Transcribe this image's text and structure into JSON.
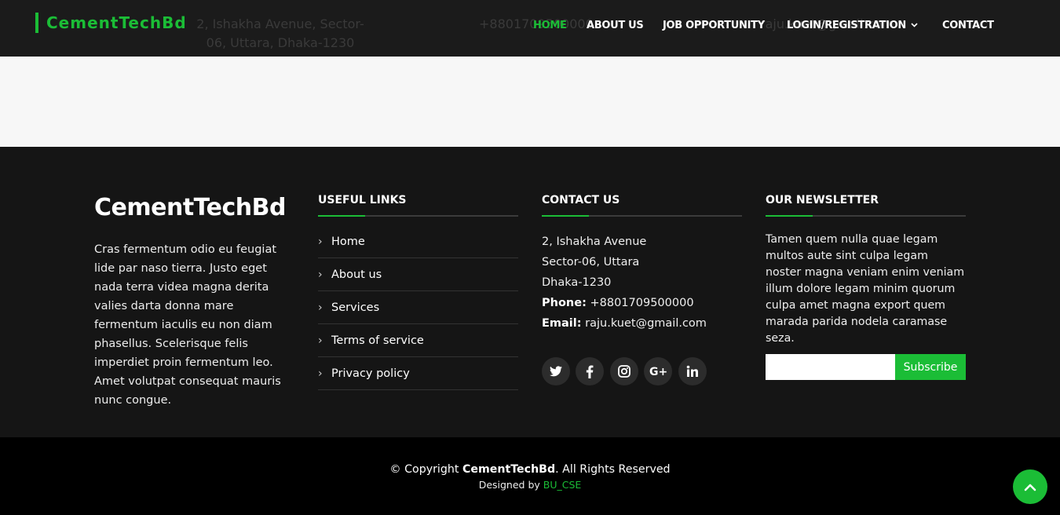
{
  "header": {
    "logo": "CementTechBd",
    "background_text": {
      "address": "2, Ishakha Avenue, Sector-06, Uttara, Dhaka-1230",
      "phone": "+8801709500000",
      "email": "raju.kuet@gmail.com"
    },
    "nav": [
      {
        "label": "HOME",
        "active": true
      },
      {
        "label": "ABOUT US"
      },
      {
        "label": "JOB OPPORTUNITY"
      },
      {
        "label": "LOGIN/REGISTRATION",
        "dropdown": true
      },
      {
        "label": "CONTACT"
      }
    ]
  },
  "footer": {
    "brand": "CementTechBd",
    "brand_description": "Cras fermentum odio eu feugiat lide par naso tierra. Justo eget nada terra videa magna derita valies darta donna mare fermentum iaculis eu non diam phasellus. Scelerisque felis imperdiet proin fermentum leo. Amet volutpat consequat mauris nunc congue.",
    "useful_links": {
      "title": "USEFUL LINKS",
      "items": [
        "Home",
        "About us",
        "Services",
        "Terms of service",
        "Privacy policy"
      ]
    },
    "contact": {
      "title": "CONTACT US",
      "address_line1": "2, Ishakha Avenue",
      "address_line2": "Sector-06, Uttara",
      "address_line3": "Dhaka-1230",
      "phone_label": "Phone:",
      "phone": "+8801709500000",
      "email_label": "Email:",
      "email": "raju.kuet@gmail.com",
      "socials": [
        "twitter-icon",
        "facebook-icon",
        "instagram-icon",
        "google-plus-icon",
        "linkedin-icon"
      ]
    },
    "newsletter": {
      "title": "OUR NEWSLETTER",
      "text": "Tamen quem nulla quae legam multos aute sint culpa legam noster magna veniam enim veniam illum dolore legam minim quorum culpa amet magna export quem marada parida nodela caramase seza.",
      "input_value": "",
      "button_label": "Subscribe"
    },
    "copyright_prefix": "© Copyright ",
    "copyright_brand": "CementTechBd",
    "copyright_suffix": ". All Rights Reserved",
    "designed_by_prefix": "Designed by ",
    "designed_by_link": "BU_CSE"
  },
  "colors": {
    "accent": "#1bbd36",
    "header_bg": "#1b1b1b",
    "footer_bg": "#151515",
    "bottom_bg": "#000000"
  }
}
